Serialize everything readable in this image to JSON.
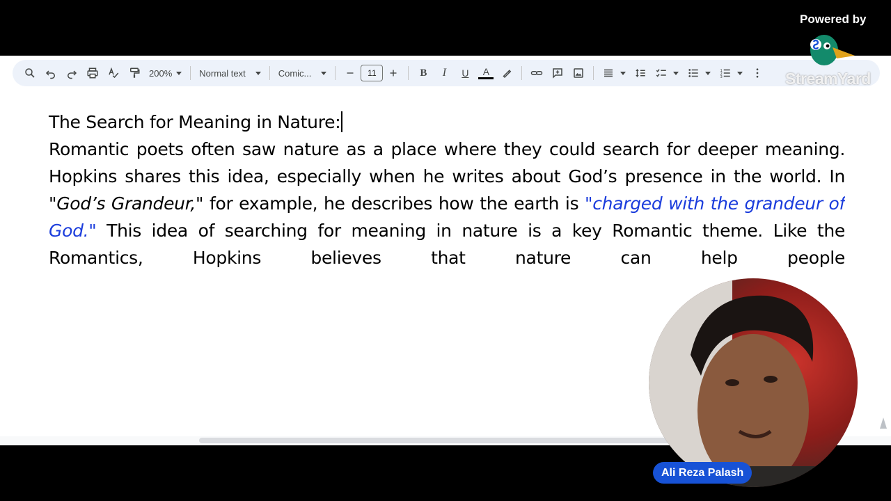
{
  "toolbar": {
    "zoom": "200%",
    "style": "Normal text",
    "font": "Comic...",
    "font_size": "11",
    "bold_label": "B",
    "italic_label": "I",
    "underline_label": "U",
    "text_color_label": "A",
    "icons": [
      "search-icon",
      "undo-icon",
      "redo-icon",
      "print-icon",
      "spellcheck-icon",
      "paint-format-icon",
      "link-icon",
      "comment-icon",
      "image-icon",
      "align-icon",
      "line-spacing-icon",
      "checklist-icon",
      "bullet-list-icon",
      "numbered-list-icon",
      "more-icon"
    ]
  },
  "document": {
    "heading": "The Search for Meaning in Nature:",
    "p_part1": "Romantic poets often saw nature as a place where they could search for deeper meaning. Hopkins shares this idea, especially when he writes about God’s presence in the world. In ",
    "p_quote_title": "\"God’s Grandeur,\"",
    "p_part2": " for example, he describes how the earth is ",
    "p_link_quote": "\"charged with the grandeur of God.\"",
    "p_part3": " This idea of searching for meaning in nature is a key Romantic theme. Like the Romantics, Hopkins believes that nature can help people"
  },
  "overlay": {
    "powered_by": "Powered by",
    "brand": "StreamYard",
    "presenter_name": "Ali Reza Palash"
  },
  "colors": {
    "toolbar_bg": "#edf2fa",
    "link_blue": "#1a3cdc",
    "name_pill": "#1752d6"
  }
}
